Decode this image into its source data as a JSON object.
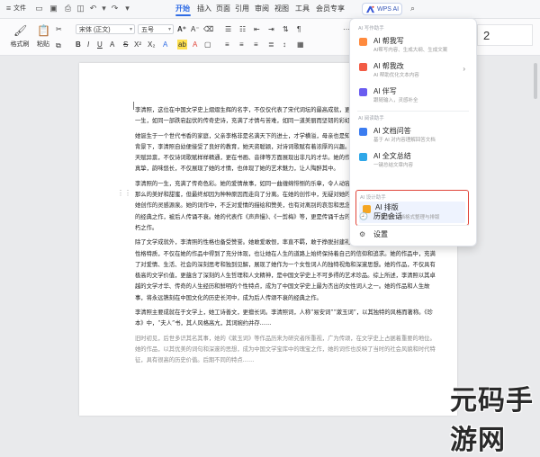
{
  "topbar": {
    "file": "文件",
    "tabs": [
      "开始",
      "插入",
      "页面",
      "引用",
      "审阅",
      "视图",
      "工具",
      "会员专享"
    ],
    "active_tab": "开始",
    "wps_ai": "WPS AI"
  },
  "ribbon": {
    "format_painter": "格式刷",
    "paste": "粘贴",
    "font_name": "宋体 (正文)",
    "font_size": "五号",
    "style_preview": "2",
    "colors": {
      "accent": "#2f6ce5",
      "highlight_border": "#e0453a",
      "ai_blue": "#3556b8"
    }
  },
  "document": {
    "paragraphs": [
      "李清照，这位在中国文学史上熠熠生辉的名字，不仅仅代表了宋代词坛的最高成就，更是古代女性文学的璀璨瑰宝。她的一生，如同一部跌宕起伏的传奇史诗，充满了才情与苦难，如同一道美丽而坚韧的彩虹，映照出她人生的光影。",
      "她诞生于一个世代书香的家庭，父亲李格非是名满天下的进士，才学横溢，母亲也是知书达理、温柔贤淑。在这样的家庭背景下，李清照自幼便接受了良好的教育，她天资聪颖，对诗词歌赋有着浓厚的兴趣。她在书香的熏陶中，她聪明伶俐，天赋异禀，不仅诗词歌赋样样精通，更在书画、音律等方面展现出非凡的才华。她的作品，每一首都打动人心，情感深沉真挚，韵味悠长，不仅展现了她的才情，也体现了她的艺术魅力，让人陶醉其中。",
      "李清照的一生，充满了传奇色彩。她的爱情故事，如同一曲缠绵悱恻的乐章，令人动容。她与丈夫赵明诚的爱情，曾经是那么的美好和甜蜜，但最终却因为种种原因而走向了分离。在她的创作中，无疑对她的人生产生了深远的影响，也成为了她创作的灵感源泉。她的词作中，不乏对爱情的描绘和赞美，也有对离别的哀怨和思念，这些作品都成为了中国文学史上的经典之作，被后人传诵不衰。她的代表作《声声慢》、《一剪梅》等，更是传诵千古的佳作，成为了中国古典文学中的不朽之作。",
      "除了文学成就外，李清照的性格也备受赞誉。她敢爱敢恨，率直不羁，敢于挣脱封建礼教的束缚，追求自由和独立。这种性格特质，不仅在她的作品中得到了充分体现，也让她在人生的道路上始终保持着自己的信仰和追求。她的作品中，充满了对爱情、生活、社会的深刻思考和独到见解，展现了她作为一个女性词人的独特视角和深邃思想。她的作品，不仅具有极高的文学价值，更蕴含了深刻的人生哲理和人文精神，是中国文学史上不可多得的艺术珍品。综上所述，李清照以其卓越的文学才华、传奇的人生经历和鲜明的个性特点，成为了中国文学史上最为杰出的女性词人之一。她的作品和人生故事，将永远镌刻在中国文化的历史长河中，成为后人传颂不衰的经典之作。",
      "李清照主要成就在于文学上，她工诗善文，更擅长词。李清照词，人称“易安词”“漱玉词”，以其独特的风格而著称。《珍本》中，“夫人”书，其人风格高亢，其词婉约并存……",
      "旧时初见，后世多识其名其事，她的《漱玉词》等作品历来为研究者所重视，广为传颂，在文学史上占据着重要的地位。她的作品，以其优美的词句和深邃的思想，成为中国文学宝库中的瑰宝之作，她的词作也反映了当时的社会风貌和时代特征，具有很高的历史价值。后期不同的特点……"
    ]
  },
  "ai_panel": {
    "section_writing": "AI 写作助手",
    "section_reading": "AI 阅读助手",
    "section_design": "AI 设计助手",
    "items": [
      {
        "title": "AI 帮我写",
        "sub": "AI帮写内容、生成大纲、生成文案",
        "has_arrow": false
      },
      {
        "title": "AI 帮我改",
        "sub": "AI 帮助优化文本内容",
        "has_arrow": true
      },
      {
        "title": "AI 伴写",
        "sub": "跟随输入，灵感补全",
        "has_arrow": false
      },
      {
        "title": "AI 文档问答",
        "sub": "基于 AI 对内容理解回答文档",
        "has_arrow": false
      },
      {
        "title": "AI 全文总结",
        "sub": "一键总结文章内容",
        "has_arrow": false
      },
      {
        "title": "AI 排版",
        "sub": "一键将长文档格式整理与排版",
        "has_arrow": false
      },
      {
        "title": "历史会话",
        "sub": "",
        "has_arrow": false
      },
      {
        "title": "设置",
        "sub": "",
        "has_arrow": false
      }
    ]
  },
  "watermark": "元码手游网"
}
